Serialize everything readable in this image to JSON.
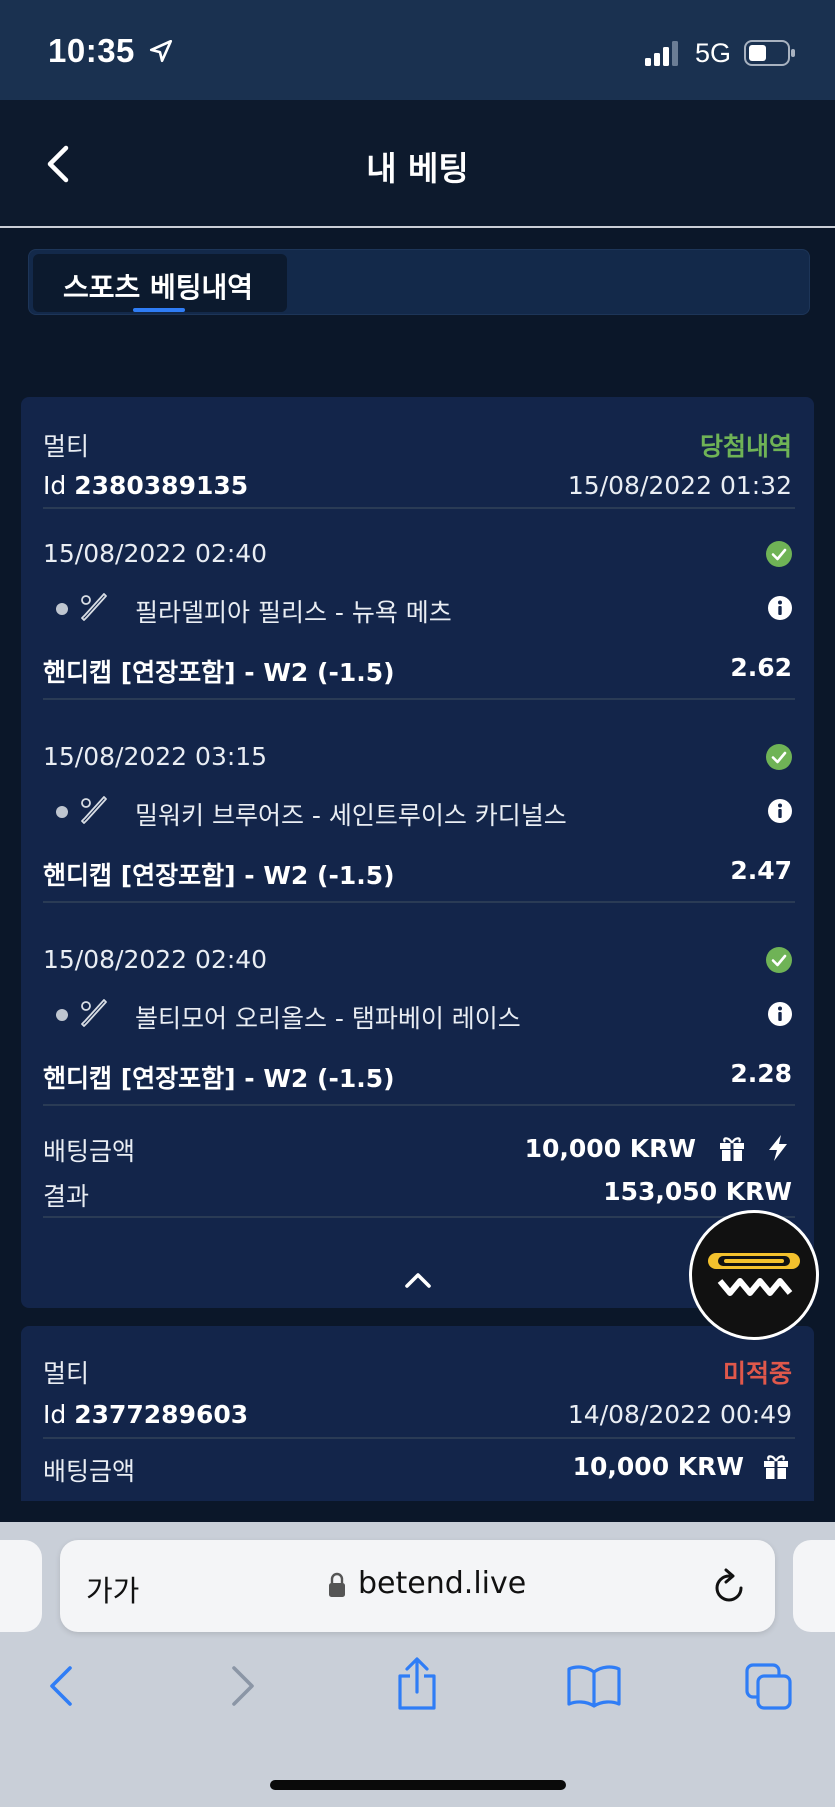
{
  "status_bar": {
    "time": "10:35",
    "network": "5G",
    "battery_icon": "battery-icon",
    "signal_icon": "signal-icon"
  },
  "header": {
    "title": "내 베팅",
    "back_icon": "chevron-left-icon"
  },
  "tabs": [
    {
      "label": "스포츠 베팅내역",
      "active": true
    }
  ],
  "colors": {
    "win": "#6fb356",
    "loss": "#e0584b",
    "accent": "#2f7df6",
    "card": "#13254a",
    "background": "#0b1729"
  },
  "bets": [
    {
      "type": "멀티",
      "status": "당첨내역",
      "id_label": "Id",
      "id": "2380389135",
      "placed_at": "15/08/2022 01:32",
      "selections": [
        {
          "date": "15/08/2022 02:40",
          "match": "필라델피아 필리스 - 뉴욕 메츠",
          "market": "핸디캡 [연장포함] - W2 (-1.5)",
          "odds": "2.62",
          "result_icon": "check-circle-icon"
        },
        {
          "date": "15/08/2022 03:15",
          "match": "밀워키 브루어즈 - 세인트루이스 카디널스",
          "market": "핸디캡 [연장포함] - W2 (-1.5)",
          "odds": "2.47",
          "result_icon": "check-circle-icon"
        },
        {
          "date": "15/08/2022 02:40",
          "match": "볼티모어 오리올스 - 탬파베이 레이스",
          "market": "핸디캡 [연장포함] - W2 (-1.5)",
          "odds": "2.28",
          "result_icon": "check-circle-icon"
        }
      ],
      "stake_label": "배팅금액",
      "stake": "10,000 KRW",
      "result_label": "결과",
      "result": "153,050 KRW"
    },
    {
      "type": "멀티",
      "status": "미적중",
      "id_label": "Id",
      "id": "2377289603",
      "placed_at": "14/08/2022 00:49",
      "stake_label": "배팅금액",
      "stake": "10,000 KRW"
    }
  ],
  "browser": {
    "text_size_button": "가가",
    "url": "betend.live"
  }
}
